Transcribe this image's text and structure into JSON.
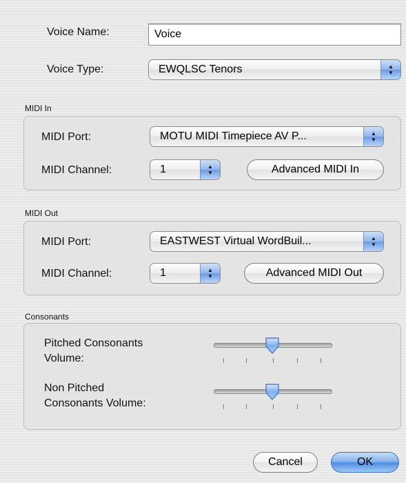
{
  "voice_name": {
    "label": "Voice Name:",
    "value": "Voice"
  },
  "voice_type": {
    "label": "Voice Type:",
    "selected": "EWQLSC Tenors"
  },
  "midi_in": {
    "title": "MIDI In",
    "port_label": "MIDI Port:",
    "port_selected": "MOTU MIDI Timepiece AV P...",
    "channel_label": "MIDI Channel:",
    "channel_selected": "1",
    "advanced_label": "Advanced MIDI In"
  },
  "midi_out": {
    "title": "MIDI Out",
    "port_label": "MIDI Port:",
    "port_selected": "EASTWEST Virtual WordBuil...",
    "channel_label": "MIDI Channel:",
    "channel_selected": "1",
    "advanced_label": "Advanced MIDI Out"
  },
  "consonants": {
    "title": "Consonants",
    "pitched_label_1": "Pitched Consonants",
    "pitched_label_2": "Volume:",
    "pitched_value": 0.5,
    "nonpitched_label_1": "Non Pitched",
    "nonpitched_label_2": "Consonants Volume:",
    "nonpitched_value": 0.5
  },
  "buttons": {
    "cancel": "Cancel",
    "ok": "OK"
  },
  "colors": {
    "accent": "#4c8be0",
    "default_button_border": "#3a6dbc"
  }
}
